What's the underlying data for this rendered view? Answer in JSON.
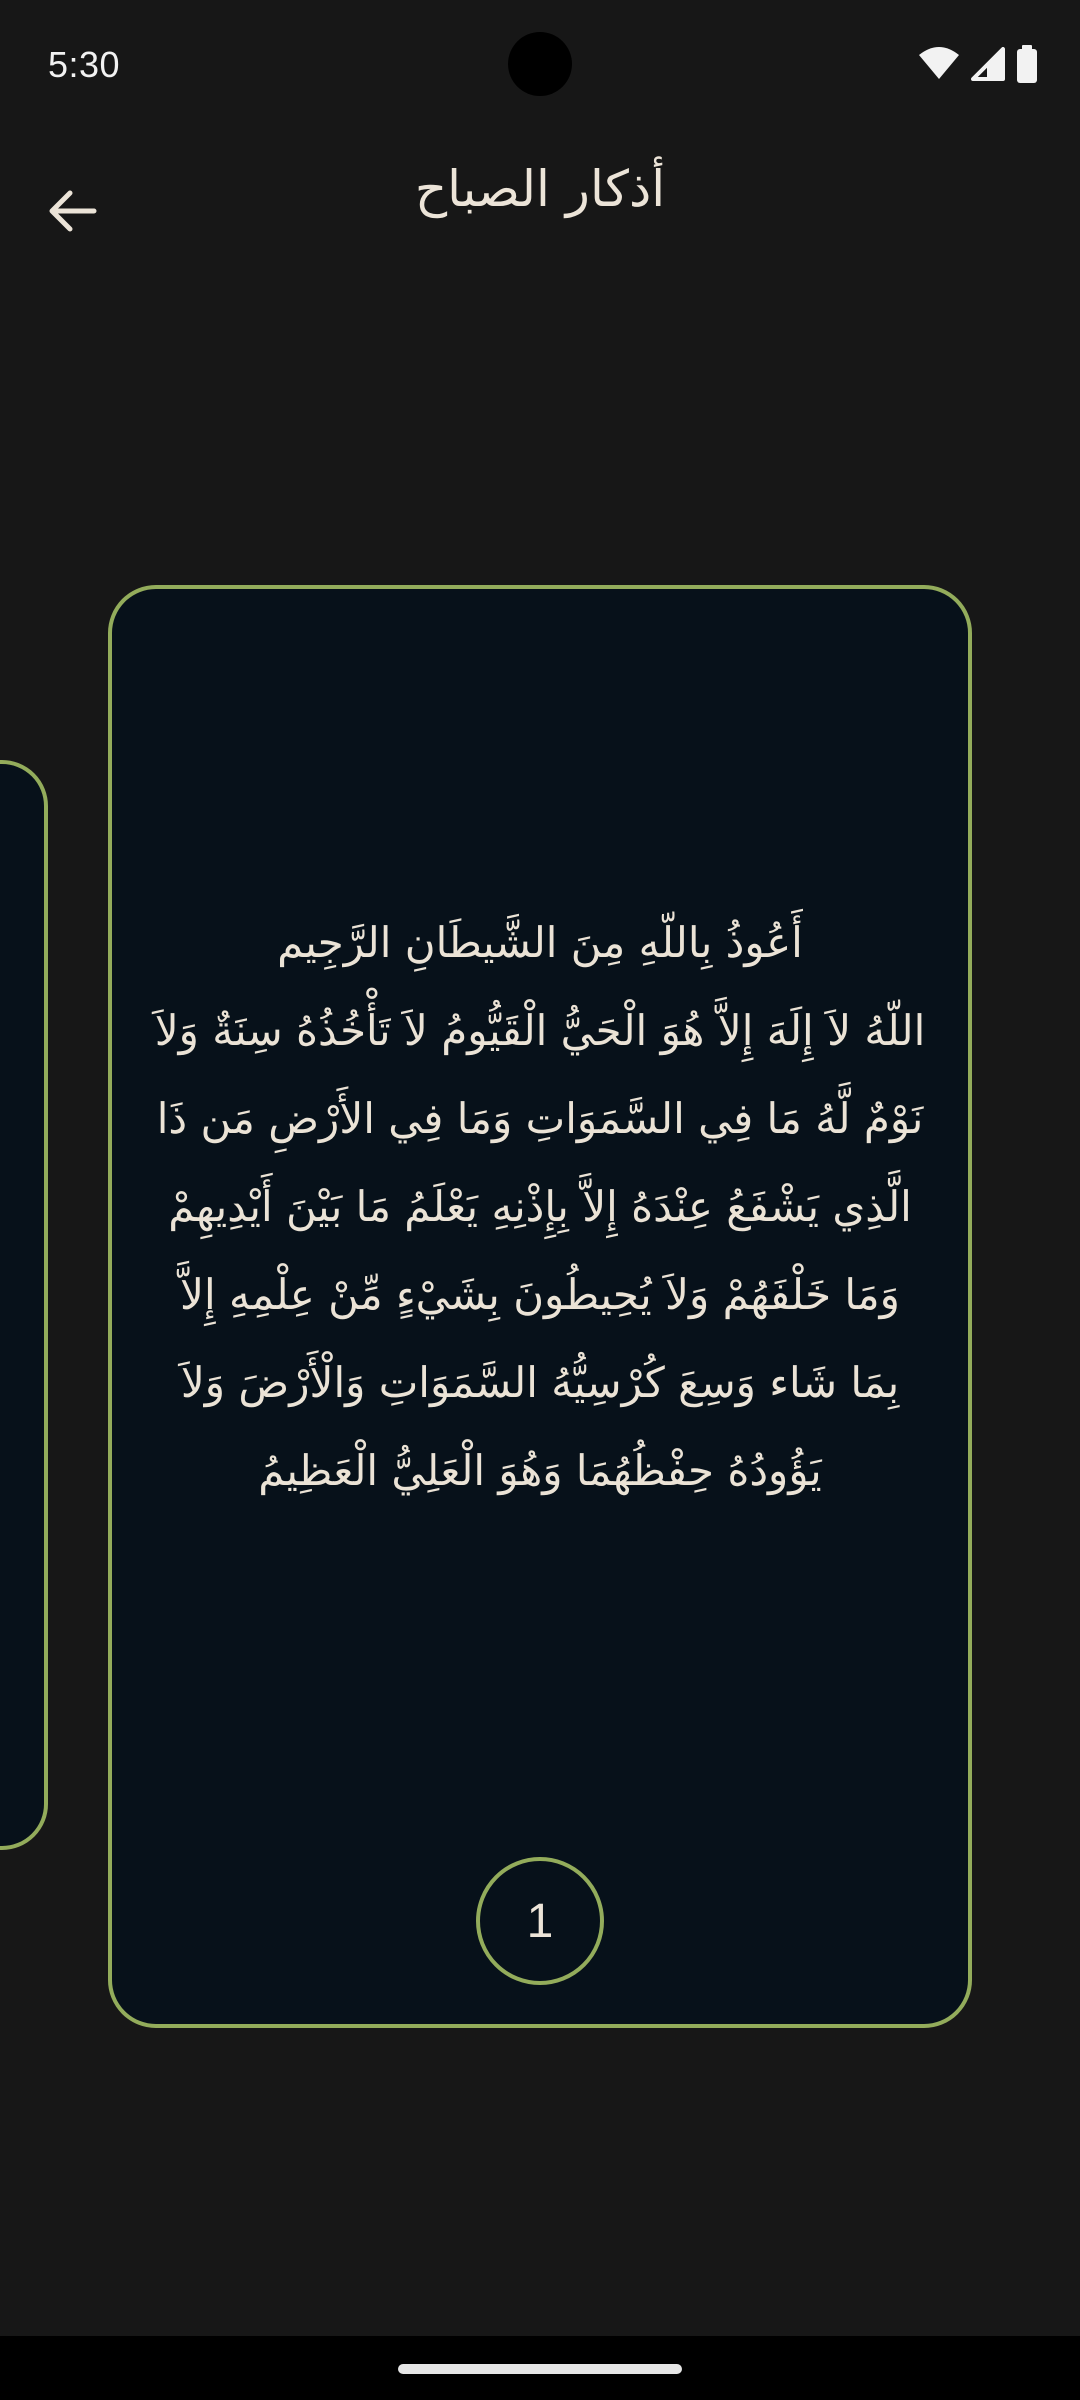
{
  "status_bar": {
    "time": "5:30",
    "icons": [
      "wifi-icon",
      "cellular-signal-icon",
      "battery-icon"
    ]
  },
  "app_bar": {
    "back_icon": "arrow-back-icon",
    "title": "أذكار الصباح"
  },
  "card": {
    "text": "أَعُوذُ بِاللّهِ مِنَ الشَّيطَانِ الرَّجِيم\nاللّهُ لاَ إِلَهَ إِلاَّ هُوَ الْحَيُّ الْقَيُّومُ لاَ تَأْخُذُهُ سِنَةٌ وَلاَ نَوْمٌ لَّهُ مَا فِي السَّمَوَاتِ وَمَا فِي الأَرْضِ مَن ذَا الَّذِي يَشْفَعُ عِنْدَهُ إِلاَّ بِإِذْنِهِ يَعْلَمُ مَا بَيْنَ أَيْدِيهِمْ وَمَا خَلْفَهُمْ وَلاَ يُحِيطُونَ بِشَيْءٍ مِّنْ عِلْمِهِ إِلاَّ بِمَا شَاء وَسِعَ كُرْسِيُّهُ السَّمَوَاتِ وَالْأَرْضَ وَلاَ يَؤُودُهُ حِفْظُهُمَا وَهُوَ الْعَلِيُّ الْعَظِيمُ",
    "counter": "1"
  },
  "colors": {
    "background": "#171717",
    "card_background": "#07111a",
    "accent_border": "#93ac5b",
    "text": "#ebe3d6"
  }
}
